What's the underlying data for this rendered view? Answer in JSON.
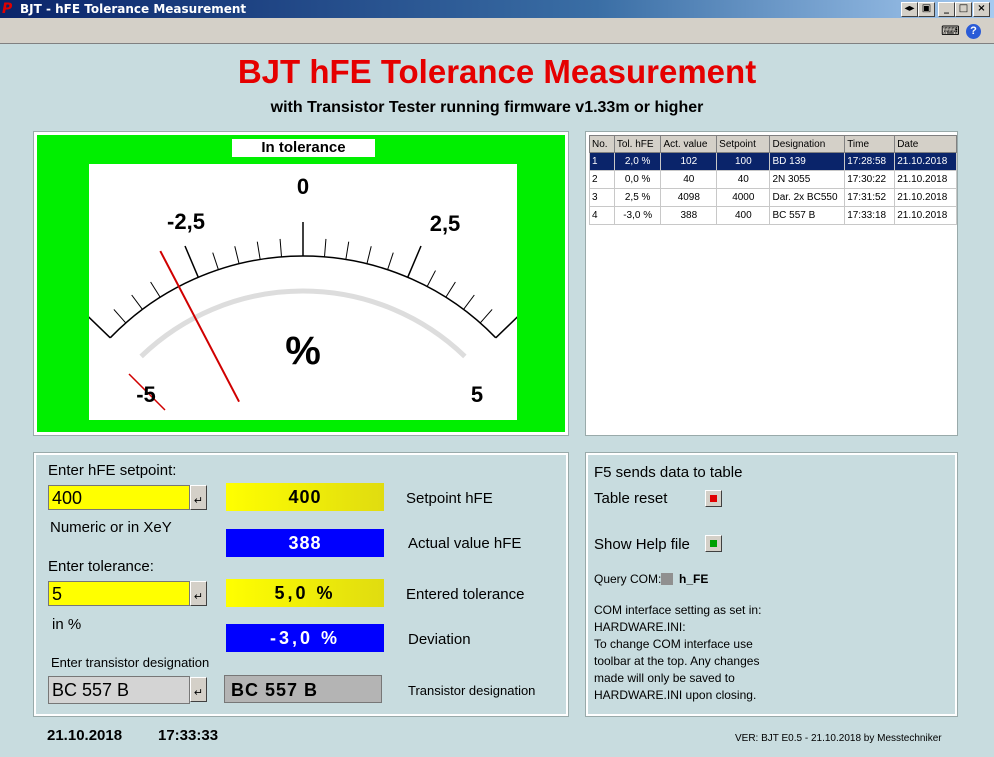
{
  "window": {
    "title": "BJT - hFE Tolerance Measurement",
    "app_icon": "P"
  },
  "header": {
    "title": "BJT hFE Tolerance Measurement",
    "subtitle": "with Transistor Tester running firmware v1.33m or higher"
  },
  "meter": {
    "status": "In tolerance",
    "label_0": "0",
    "label_m25": "-2,5",
    "label_p25": "2,5",
    "label_m5": "-5",
    "label_p5": "5",
    "unit": "%",
    "deviation_percent": -3.0,
    "face_color": "#00ef00",
    "needle_color": "#d00000"
  },
  "table": {
    "columns": [
      "No.",
      "Tol. hFE",
      "Act. value",
      "Setpoint",
      "Designation",
      "Time",
      "Date"
    ],
    "rows": [
      [
        "1",
        "2,0 %",
        "102",
        "100",
        "BD 139",
        "17:28:58",
        "21.10.2018"
      ],
      [
        "2",
        "0,0 %",
        "40",
        "40",
        "2N 3055",
        "17:30:22",
        "21.10.2018"
      ],
      [
        "3",
        "2,5 %",
        "4098",
        "4000",
        "Dar. 2x BC550",
        "17:31:52",
        "21.10.2018"
      ],
      [
        "4",
        "-3,0 %",
        "388",
        "400",
        "BC 557 B",
        "17:33:18",
        "21.10.2018"
      ]
    ],
    "selected_row": 0
  },
  "inputs": {
    "setpoint_label": "Enter hFE setpoint:",
    "setpoint_value": "400",
    "setpoint_hint": "Numeric or in XeY",
    "tolerance_label": "Enter tolerance:",
    "tolerance_value": "5",
    "tolerance_hint": "in %",
    "designation_label": "Enter transistor designation",
    "designation_value": "BC 557 B"
  },
  "displays": {
    "setpoint": "400",
    "setpoint_label": "Setpoint hFE",
    "actual": "388",
    "actual_label": "Actual value hFE",
    "tolerance": "5,0 %",
    "tolerance_label": "Entered tolerance",
    "deviation": "-3,0 %",
    "deviation_label": "Deviation",
    "designation": "BC 557 B",
    "designation_label": "Transistor designation"
  },
  "controls": {
    "f5_text": "F5 sends data to table",
    "table_reset": "Table reset",
    "show_help": "Show Help file",
    "query_com_label": "Query COM:",
    "query_com_value": "h_FE",
    "note_lines": [
      "COM interface setting as set in:",
      "HARDWARE.INI:",
      "To change COM interface use",
      " toolbar at the top. Any changes",
      " made will only be saved to",
      " HARDWARE.INI upon closing."
    ],
    "reset_led_color": "#e00000",
    "help_led_color": "#00a000"
  },
  "footer": {
    "date": "21.10.2018",
    "time": "17:33:33",
    "version": "VER: BJT E0.5 - 21.10.2018 by Messtechniker"
  }
}
